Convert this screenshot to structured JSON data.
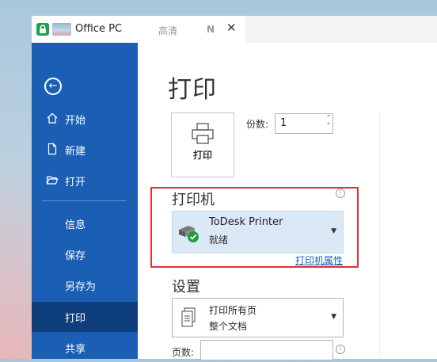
{
  "window": {
    "tab_title": "Office PC",
    "quality": "高清",
    "n_label": "N",
    "close_symbol": "✕"
  },
  "sidebar": {
    "back_icon": "←",
    "items": [
      {
        "label": "开始",
        "icon": "home-icon"
      },
      {
        "label": "新建",
        "icon": "new-document-icon"
      },
      {
        "label": "打开",
        "icon": "folder-open-icon"
      },
      {
        "label": "信息"
      },
      {
        "label": "保存"
      },
      {
        "label": "另存为"
      },
      {
        "label": "打印",
        "active": true
      },
      {
        "label": "共享"
      }
    ]
  },
  "main": {
    "title": "打印",
    "print_button_label": "打印",
    "copies_label": "份数:",
    "copies_value": "1",
    "printer_section_title": "打印机",
    "printer": {
      "name": "ToDesk Printer",
      "status": "就绪",
      "properties_link": "打印机属性"
    },
    "settings_section_title": "设置",
    "settings": {
      "line1": "打印所有页",
      "line2": "整个文档"
    },
    "pages_label": "页数:",
    "pages_value": ""
  },
  "colors": {
    "sidebar": "#1b5fb4",
    "sidebar_active": "#0f3e7d",
    "highlight": "#e0303a",
    "printer_select_bg": "#dbe8f6",
    "link": "#1b5fb4"
  }
}
